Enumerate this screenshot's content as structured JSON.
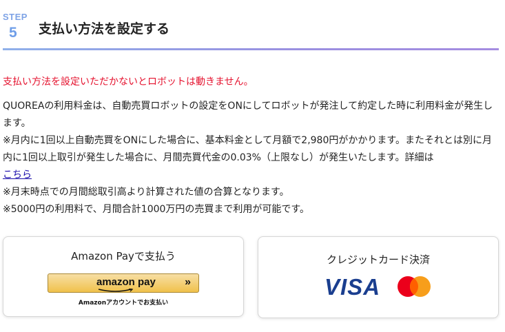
{
  "step": {
    "label": "STEP",
    "number": "5",
    "title": "支払い方法を設定する"
  },
  "warning": "支払い方法を設定いただかないとロボットは動きません。",
  "description": {
    "line1": "QUOREAの利用料金は、自動売買ロボットの設定をONにしてロボットが発注して約定した時に利用料金が発生します。",
    "line2_prefix": "※月内に1回以上自動売買をONにした場合に、基本料金として月額で2,980円がかかります。またそれとは別に月内に1回以上取引が発生した場合に、月間売買代金の0.03%（上限なし）が発生いたします。詳細は",
    "link": "こちら",
    "line3": "※月末時点での月間総取引高より計算された値の合算となります。",
    "line4": "※5000円の利用料で、月間合計1000万円の売買まで利用が可能です。"
  },
  "amazon_card": {
    "title": "Amazon Payで支払う",
    "button_logo": "amazon pay",
    "button_chevron": "»",
    "subtitle": "Amazonアカウントでお支払い"
  },
  "credit_card": {
    "title": "クレジットカード決済",
    "visa": "VISA",
    "mastercard_icon": "mastercard-icon"
  },
  "colors": {
    "step_accent": "#7ea3e6",
    "warning_red": "#e5132f",
    "link_blue": "#1a0dab",
    "visa_blue": "#1a3e8f",
    "mc_red": "#eb001b",
    "mc_orange": "#f79e1b",
    "amazon_yellow": "#f0c14b"
  }
}
